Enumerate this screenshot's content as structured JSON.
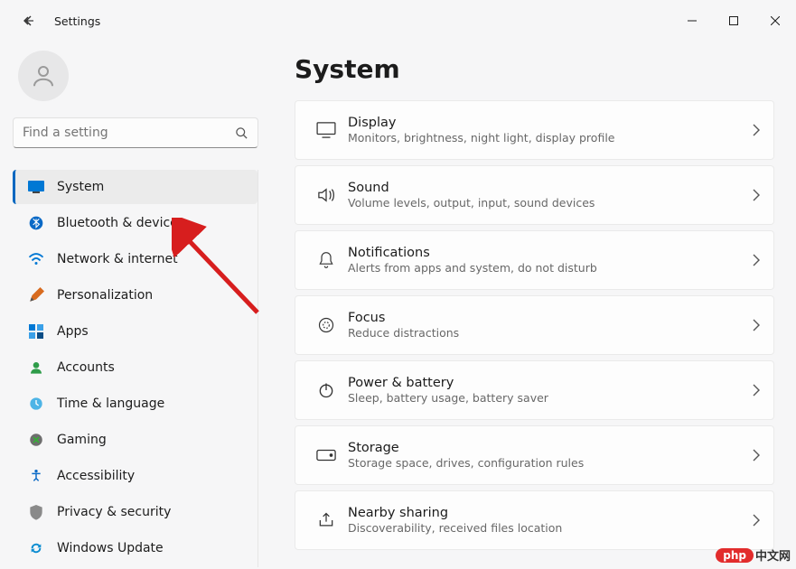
{
  "window": {
    "title": "Settings"
  },
  "search": {
    "placeholder": "Find a setting"
  },
  "sidebar": {
    "items": [
      {
        "label": "System",
        "icon": "system",
        "selected": true
      },
      {
        "label": "Bluetooth & devices",
        "icon": "bluetooth",
        "selected": false
      },
      {
        "label": "Network & internet",
        "icon": "network",
        "selected": false
      },
      {
        "label": "Personalization",
        "icon": "personalization",
        "selected": false
      },
      {
        "label": "Apps",
        "icon": "apps",
        "selected": false
      },
      {
        "label": "Accounts",
        "icon": "accounts",
        "selected": false
      },
      {
        "label": "Time & language",
        "icon": "time",
        "selected": false
      },
      {
        "label": "Gaming",
        "icon": "gaming",
        "selected": false
      },
      {
        "label": "Accessibility",
        "icon": "accessibility",
        "selected": false
      },
      {
        "label": "Privacy & security",
        "icon": "privacy",
        "selected": false
      },
      {
        "label": "Windows Update",
        "icon": "update",
        "selected": false
      }
    ]
  },
  "page": {
    "title": "System",
    "cards": [
      {
        "title": "Display",
        "subtitle": "Monitors, brightness, night light, display profile",
        "icon": "display"
      },
      {
        "title": "Sound",
        "subtitle": "Volume levels, output, input, sound devices",
        "icon": "sound"
      },
      {
        "title": "Notifications",
        "subtitle": "Alerts from apps and system, do not disturb",
        "icon": "notifications"
      },
      {
        "title": "Focus",
        "subtitle": "Reduce distractions",
        "icon": "focus"
      },
      {
        "title": "Power & battery",
        "subtitle": "Sleep, battery usage, battery saver",
        "icon": "power"
      },
      {
        "title": "Storage",
        "subtitle": "Storage space, drives, configuration rules",
        "icon": "storage"
      },
      {
        "title": "Nearby sharing",
        "subtitle": "Discoverability, received files location",
        "icon": "share"
      }
    ]
  },
  "watermark": {
    "pill": "php",
    "text": "中文网"
  }
}
